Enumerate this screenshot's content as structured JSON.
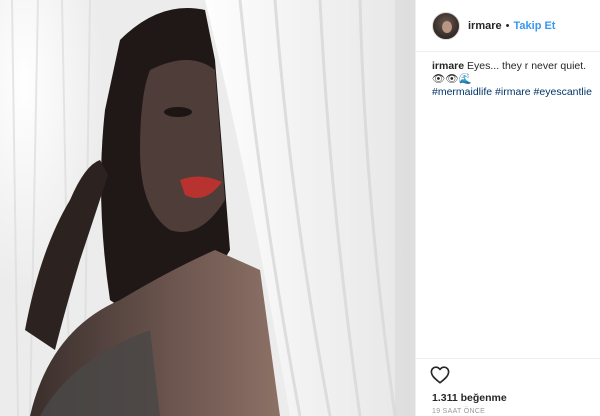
{
  "post": {
    "username": "irmare",
    "separator": "•",
    "follow_label": "Takip Et",
    "caption": {
      "username": "irmare",
      "text": "Eyes... they r never quiet. 👁👁🌊",
      "hashtags": [
        "#mermaidlife",
        "#irmare",
        "#eyescantlie"
      ]
    },
    "likes": "1.311 beğenme",
    "timestamp": "19 SAAT ÖNCE"
  },
  "icons": {
    "heart": "heart-outline-icon",
    "avatar": "profile-avatar"
  },
  "colors": {
    "link_blue": "#3897f0",
    "hashtag": "#003569",
    "muted": "#999999",
    "border": "#efefef"
  }
}
